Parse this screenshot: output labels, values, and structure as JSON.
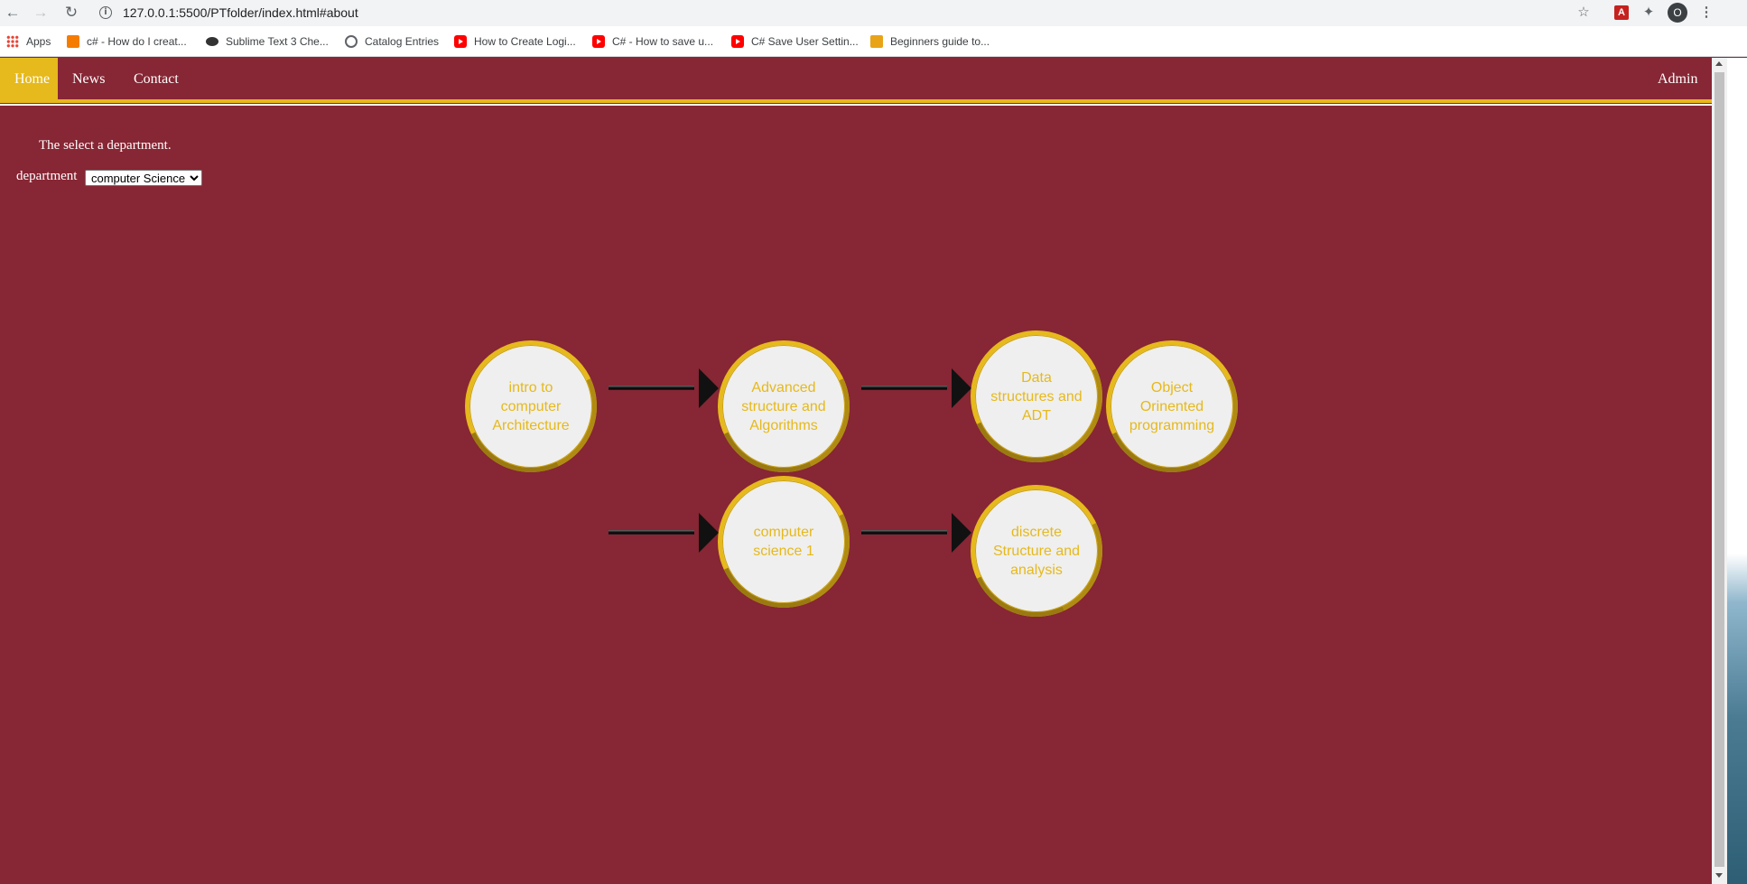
{
  "browser": {
    "url": "127.0.0.1:5500/PTfolder/index.html#about",
    "profile_initial": "O"
  },
  "bookmarks": [
    {
      "label": "Apps",
      "icon": "apps-grid-icon"
    },
    {
      "label": "c# - How do I creat...",
      "icon": "csharp-icon"
    },
    {
      "label": "Sublime Text 3 Che...",
      "icon": "sublime-icon"
    },
    {
      "label": "Catalog Entries",
      "icon": "globe-icon"
    },
    {
      "label": "How to Create Logi...",
      "icon": "youtube-icon"
    },
    {
      "label": "C# - How to save u...",
      "icon": "youtube-icon"
    },
    {
      "label": "C# Save User Settin...",
      "icon": "youtube-icon"
    },
    {
      "label": "Beginners guide to...",
      "icon": "beginners-icon"
    }
  ],
  "nav": {
    "home": "Home",
    "news": "News",
    "contact": "Contact",
    "admin": "Admin"
  },
  "page": {
    "intro": "The select a department.",
    "department_label": "department",
    "department_selected": "computer Science"
  },
  "courses": {
    "intro_arch": "intro to computer Architecture",
    "advanced": "Advanced structure and Algorithms",
    "data_structures": "Data structures and ADT",
    "oop": "Object Orinented programming",
    "cs1": "computer science 1",
    "discrete": "discrete Structure and analysis"
  },
  "colors": {
    "background": "#872634",
    "accent": "#e6b91c",
    "circle_fill": "#efefef"
  }
}
